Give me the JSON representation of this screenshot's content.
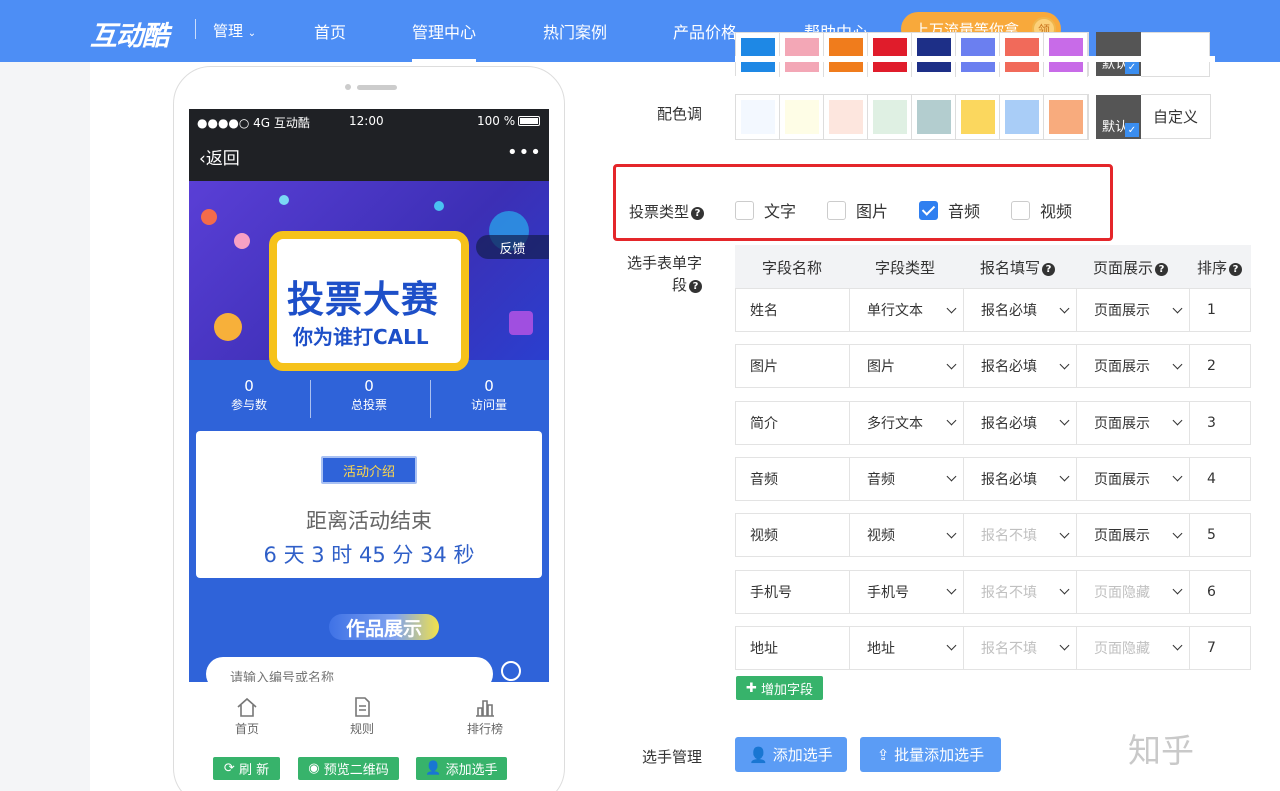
{
  "nav": {
    "logo": "互动酷",
    "manage": "管理",
    "items": [
      "首页",
      "管理中心",
      "热门案例",
      "产品价格",
      "帮助中心"
    ],
    "promo": "上万流量等你拿",
    "promo_badge": "领"
  },
  "phone": {
    "status_left": "●●●●○ 4G  互动酷",
    "status_time": "12:00",
    "status_battery": "100 %",
    "back": "返回",
    "more": "•••",
    "banner_title": "投票大赛",
    "banner_sub": "你为谁打CALL",
    "feedback": "反馈",
    "stats": [
      {
        "value": "0",
        "label": "参与数"
      },
      {
        "value": "0",
        "label": "总投票"
      },
      {
        "value": "0",
        "label": "访问量"
      }
    ],
    "intro_tag": "活动介绍",
    "intro_line1": "距离活动结束",
    "intro_line2": "6 天 3 时 45 分 34 秒",
    "works": "作品展示",
    "search_placeholder": "请输入编号或名称",
    "tabs": [
      "首页",
      "规则",
      "排行榜"
    ],
    "buttons": [
      "刷 新",
      "预览二维码",
      "添加选手"
    ]
  },
  "settings": {
    "top_swatches": [
      "#1e88e5",
      "#f3a7b6",
      "#f07c1c",
      "#e01c2b",
      "#1d2f87",
      "#6b7ff0",
      "#f16a5a",
      "#c86be8"
    ],
    "default_label": "默认",
    "color_label": "配色调",
    "color_swatches": [
      "#f3f8ff",
      "#fefde6",
      "#fde6de",
      "#dff0e3",
      "#b3cdcf",
      "#fbd75e",
      "#a9cdf7",
      "#f8ab7d"
    ],
    "custom_label": "自定义",
    "vote_type_label": "投票类型",
    "vote_types": [
      {
        "label": "文字",
        "checked": false
      },
      {
        "label": "图片",
        "checked": false
      },
      {
        "label": "音频",
        "checked": true
      },
      {
        "label": "视频",
        "checked": false
      }
    ],
    "form_label_1": "选手表单字",
    "form_label_2": "段",
    "headers": [
      "字段名称",
      "字段类型",
      "报名填写",
      "页面展示",
      "排序"
    ],
    "rows": [
      {
        "name": "姓名",
        "type": "单行文本",
        "fill": "报名必填",
        "show": "页面展示",
        "order": "1",
        "fill_dim": false,
        "show_dim": false
      },
      {
        "name": "图片",
        "type": "图片",
        "fill": "报名必填",
        "show": "页面展示",
        "order": "2",
        "fill_dim": false,
        "show_dim": false
      },
      {
        "name": "简介",
        "type": "多行文本",
        "fill": "报名必填",
        "show": "页面展示",
        "order": "3",
        "fill_dim": false,
        "show_dim": false
      },
      {
        "name": "音频",
        "type": "音频",
        "fill": "报名必填",
        "show": "页面展示",
        "order": "4",
        "fill_dim": false,
        "show_dim": false
      },
      {
        "name": "视频",
        "type": "视频",
        "fill": "报名不填",
        "show": "页面展示",
        "order": "5",
        "fill_dim": true,
        "show_dim": false
      },
      {
        "name": "手机号",
        "type": "手机号",
        "fill": "报名不填",
        "show": "页面隐藏",
        "order": "6",
        "fill_dim": true,
        "show_dim": true
      },
      {
        "name": "地址",
        "type": "地址",
        "fill": "报名不填",
        "show": "页面隐藏",
        "order": "7",
        "fill_dim": true,
        "show_dim": true
      }
    ],
    "add_field": "增加字段",
    "player_label": "选手管理",
    "add_player": "添加选手",
    "batch_add": "批量添加选手"
  },
  "watermark": "知乎"
}
